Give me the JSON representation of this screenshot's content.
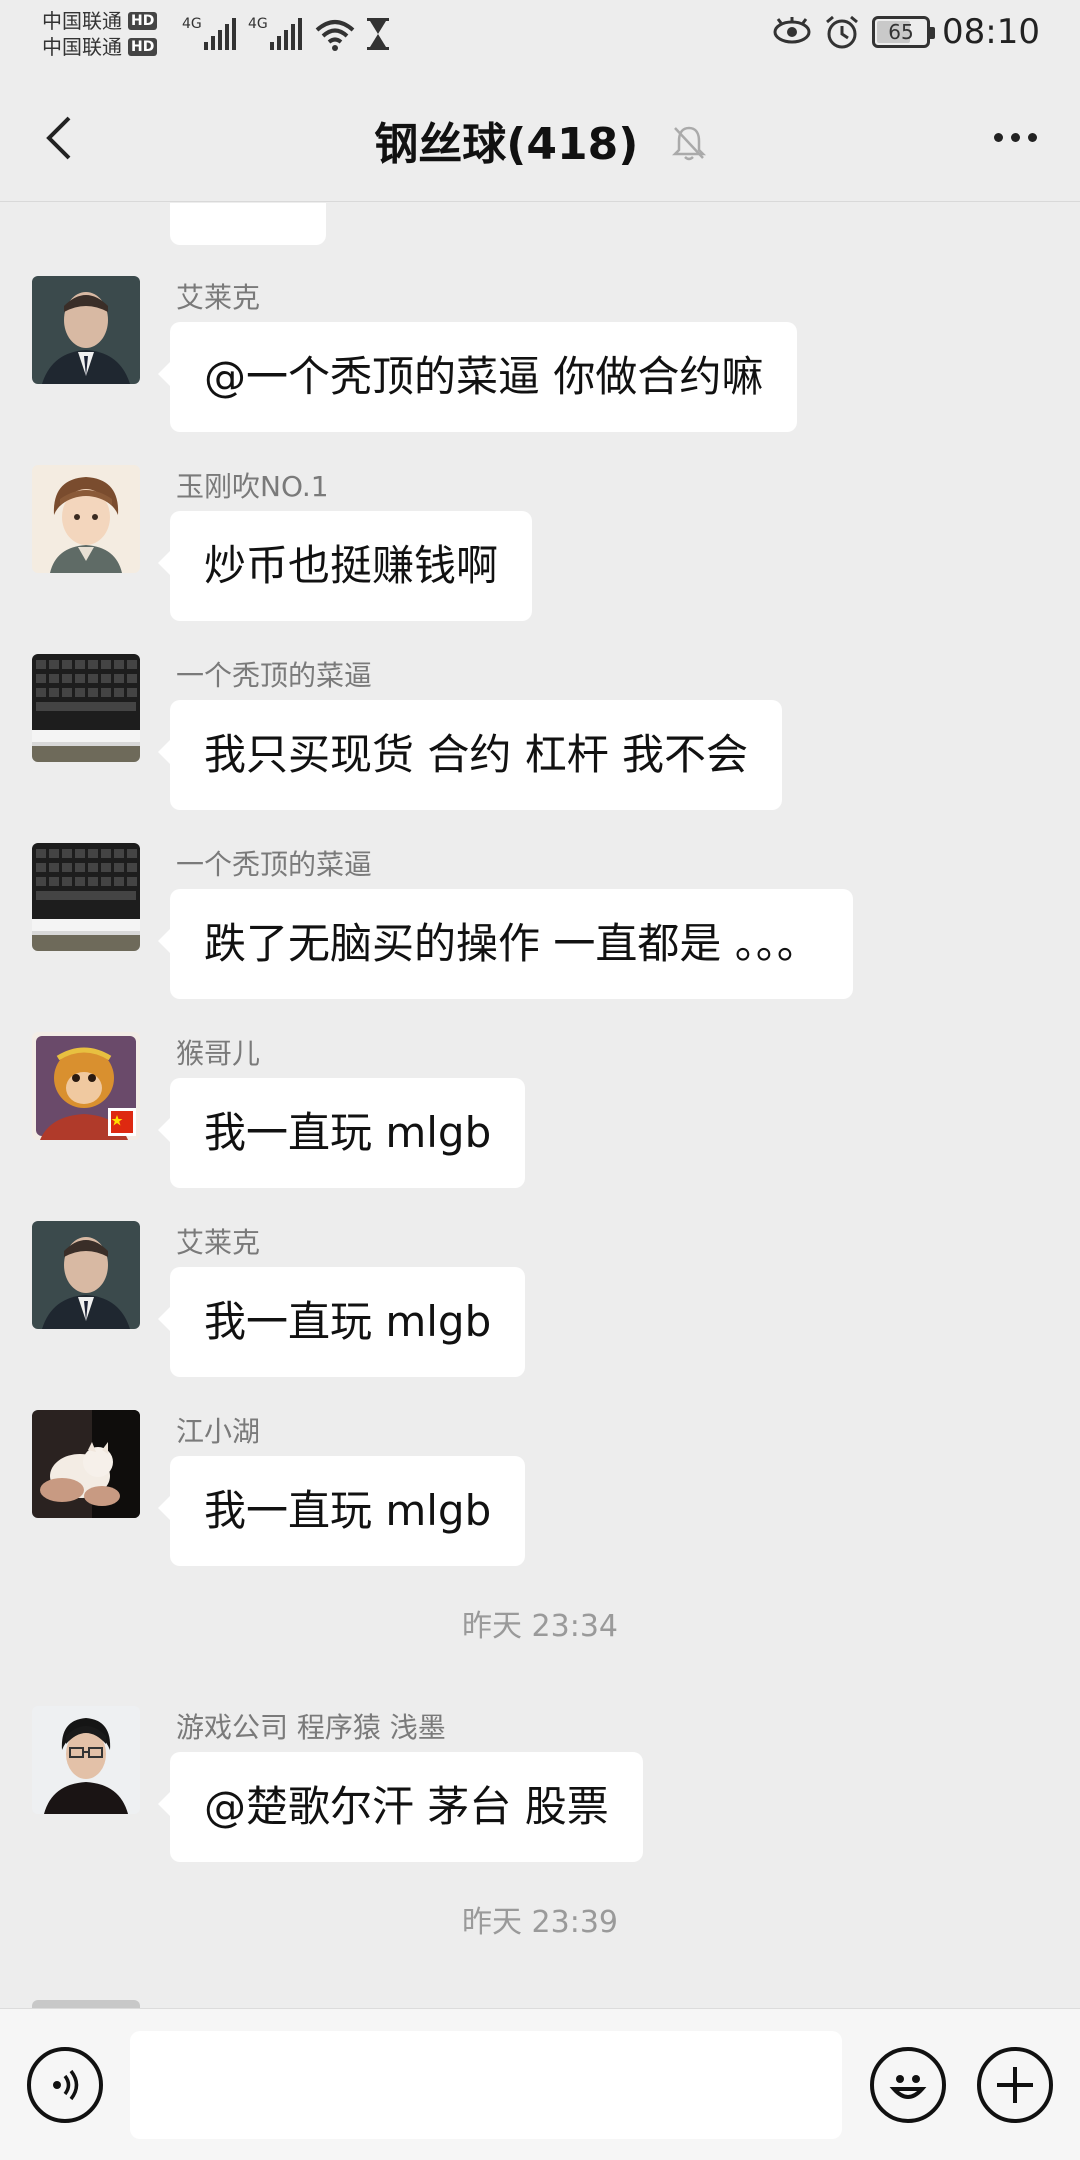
{
  "status_bar": {
    "carrier_1": "中国联通",
    "carrier_2": "中国联通",
    "hd_badge": "HD",
    "network_1": "4G",
    "network_2": "4G",
    "battery_level": "65",
    "time": "08:10"
  },
  "header": {
    "title": "钢丝球(418)"
  },
  "messages": [
    {
      "sender": "艾莱克",
      "text": "@一个秃顶的菜逼  你做合约嘛",
      "avatar": "man-in-suit"
    },
    {
      "sender": "玉刚吹NO.1",
      "text": "炒币也挺赚钱啊",
      "avatar": "anime-boy"
    },
    {
      "sender": "一个秃顶的菜逼",
      "text": "我只买现货  合约   杠杆  我不会",
      "avatar": "keyboard"
    },
    {
      "sender": "一个秃顶的菜逼",
      "text": "跌了无脑买的操作  一直都是 。。。",
      "avatar": "keyboard"
    },
    {
      "sender": "猴哥儿",
      "text": "我一直玩 mlgb",
      "avatar": "monkey-king"
    },
    {
      "sender": "艾莱克",
      "text": "我一直玩 mlgb",
      "avatar": "man-in-suit"
    },
    {
      "sender": "江小湖",
      "text": "我一直玩 mlgb",
      "avatar": "cat"
    },
    {
      "sender": "游戏公司 程序猿 浅墨",
      "text": "@楚歌尔汗  茅台  股票",
      "avatar": "young-man"
    }
  ],
  "timestamps": [
    "昨天 23:34",
    "昨天 23:39"
  ],
  "colors": {
    "background": "#ededed",
    "bubble": "#ffffff",
    "sender_text": "#7a7a7a",
    "timestamp_text": "#9a9a9a"
  },
  "icons": {
    "back": "chevron-left-icon",
    "mute": "bell-off-icon",
    "more": "more-dots-icon",
    "voice": "voice-icon",
    "emoji": "emoji-icon",
    "plus": "plus-icon"
  }
}
